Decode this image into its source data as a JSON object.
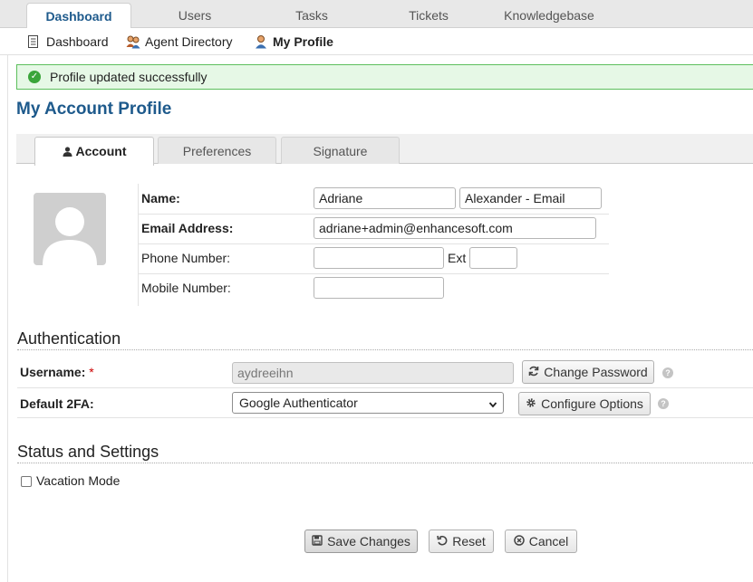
{
  "top_nav": {
    "tabs": [
      {
        "label": "Dashboard",
        "active": true
      },
      {
        "label": "Users",
        "active": false
      },
      {
        "label": "Tasks",
        "active": false
      },
      {
        "label": "Tickets",
        "active": false
      },
      {
        "label": "Knowledgebase",
        "active": false
      }
    ]
  },
  "sub_nav": {
    "items": [
      {
        "label": "Dashboard",
        "icon": "document-icon"
      },
      {
        "label": "Agent Directory",
        "icon": "users-icon"
      },
      {
        "label": "My Profile",
        "icon": "user-icon",
        "active": true
      }
    ]
  },
  "banner": {
    "message": "Profile updated successfully",
    "color": "#5cbf5c"
  },
  "page_title": "My Account Profile",
  "profile_tabs": [
    {
      "label": "Account",
      "active": true
    },
    {
      "label": "Preferences",
      "active": false
    },
    {
      "label": "Signature",
      "active": false
    }
  ],
  "account": {
    "name_label": "Name:",
    "first_name": "Adriane",
    "last_name": "Alexander - Email",
    "email_label": "Email Address:",
    "email": "adriane+admin@enhancesoft.com",
    "phone_label": "Phone Number:",
    "phone": "",
    "ext_label": "Ext",
    "ext": "",
    "mobile_label": "Mobile Number:",
    "mobile": ""
  },
  "authentication": {
    "title": "Authentication",
    "username_label": "Username:",
    "required_mark": "*",
    "username": "aydreeihn",
    "change_password_label": "Change Password",
    "twofa_label": "Default 2FA:",
    "twofa_value": "Google Authenticator",
    "configure_label": "Configure Options",
    "help_glyph": "?"
  },
  "status": {
    "title": "Status and Settings",
    "vacation_label": "Vacation Mode",
    "vacation_checked": false
  },
  "actions": {
    "save_label": "Save Changes",
    "reset_label": "Reset",
    "cancel_label": "Cancel"
  },
  "colors": {
    "accent": "#1e5a8c",
    "required": "#cc0000"
  }
}
